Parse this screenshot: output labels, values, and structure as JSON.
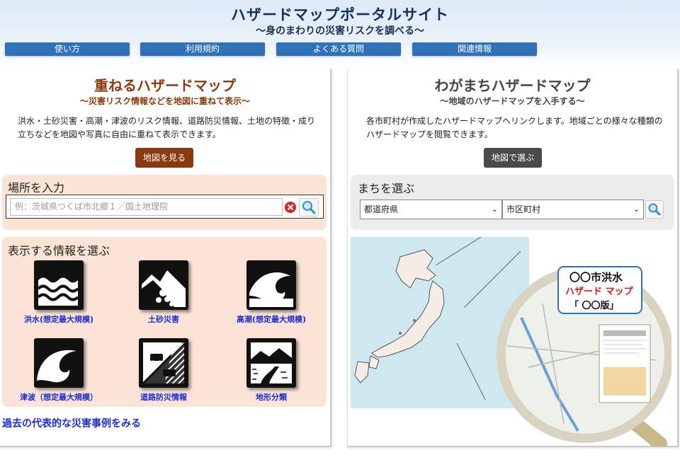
{
  "header": {
    "title": "ハザードマップポータルサイト",
    "subtitle": "〜身のまわりの災害リスクを調べる〜",
    "nav": [
      "使い方",
      "利用規約",
      "よくある質問",
      "関連情報"
    ]
  },
  "left": {
    "title": "重ねるハザードマップ",
    "subtitle": "〜災害リスク情報などを地図に重ねて表示〜",
    "desc_line1": "洪水・土砂災害・高潮・津波のリスク情報、道路防災情報、土地の特徴・成り",
    "desc_line2": "立ちなどを地図や写真に自由に重ねて表示できます。",
    "map_button": "地図を見る",
    "search_title": "場所を入力",
    "search_placeholder": "例：茨城県つくば市北郷１／国土地理院",
    "info_title": "表示する情報を選ぶ",
    "hazards": [
      "洪水(想定最大規模)",
      "土砂災害",
      "高潮(想定最大規模)",
      "津波（想定最大規模）",
      "道路防災情報",
      "地形分類"
    ],
    "past_link": "過去の代表的な災害事例をみる"
  },
  "right": {
    "title": "わがまちハザードマップ",
    "subtitle": "〜地域のハザードマップを入手する〜",
    "desc_line1": "各市町村が作成したハザードマップへリンクします。地域ごとの様々な種類の",
    "desc_line2": "ハザードマップを閲覧できます。",
    "map_button": "地図で選ぶ",
    "town_title": "まちを選ぶ",
    "pref_select": "都道府県",
    "city_select": "市区町村",
    "lens_line1": "〇〇市洪水",
    "lens_line2": "ハザード マップ",
    "lens_line3": "「 〇〇版」"
  },
  "colors": {
    "nav": "#2f72b9",
    "left_accent": "#8a3a0e",
    "left_box": "#fbe3d6",
    "right_box": "#ececec",
    "right_btn": "#4a4a4a",
    "link": "#1a2dd6"
  },
  "icons": [
    "clear-icon",
    "search-icon",
    "flood-icon",
    "landslide-icon",
    "storm-surge-icon",
    "tsunami-icon",
    "road-disaster-icon",
    "landform-icon",
    "chevron-down-icon"
  ]
}
